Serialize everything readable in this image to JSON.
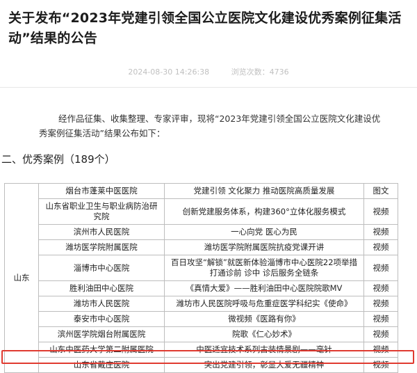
{
  "article": {
    "title": "关于发布“2023年党建引领全国公立医院文化建设优秀案例征集活动”结果的公告",
    "date": "2024-08-30 14:26:38",
    "views": "浏览次数：4736",
    "intro": "经作品征集、收集整理、专家评审，现将“2023年党建引领全国公立医院文化建设优秀案例征集活动”结果公布如下："
  },
  "section": {
    "title": "二、优秀案例（189个）"
  },
  "table": {
    "province": "山东",
    "rows": [
      {
        "hospital": "烟台市蓬莱中医医院",
        "project": "党建引领 文化聚力 推动医院高质量发展",
        "type": "图文"
      },
      {
        "hospital": "山东省职业卫生与职业病防治研究院",
        "project": "创新党建服务体系，构建360°立体化服务模式",
        "type": "视频"
      },
      {
        "hospital": "滨州市人民医院",
        "project": "一心向党 医心为民",
        "type": "视频"
      },
      {
        "hospital": "潍坊医学院附属医院",
        "project": "潍坊医学院附属医院抗疫党课开讲",
        "type": "视频"
      },
      {
        "hospital": "淄博市中心医院",
        "project": "百日攻坚“解锁”就医新体验淄博市中心医院22项举措打通诊前 诊中 诊后服务全链条",
        "type": "视频"
      },
      {
        "hospital": "胜利油田中心医院",
        "project": "《真情大爱》——胜利油田中心医院院歌MV",
        "type": "视频"
      },
      {
        "hospital": "潍坊市人民医院",
        "project": "潍坊市人民医院呼吸与危重症医学科纪实《使命》",
        "type": "视频"
      },
      {
        "hospital": "泰安市中心医院",
        "project": "微视频《医路有你》",
        "type": "视频"
      },
      {
        "hospital": "滨州医学院烟台附属医院",
        "project": "院歌《仁心妙术》",
        "type": "视频"
      },
      {
        "hospital": "山东中医药大学第二附属医院",
        "project": "中医适宜技术系列古装情景剧——毫针",
        "type": "视频"
      },
      {
        "hospital": "山东省戴庄医院",
        "project": "突出党建引领，彰显大爱无疆精神",
        "type": "视频"
      }
    ]
  }
}
